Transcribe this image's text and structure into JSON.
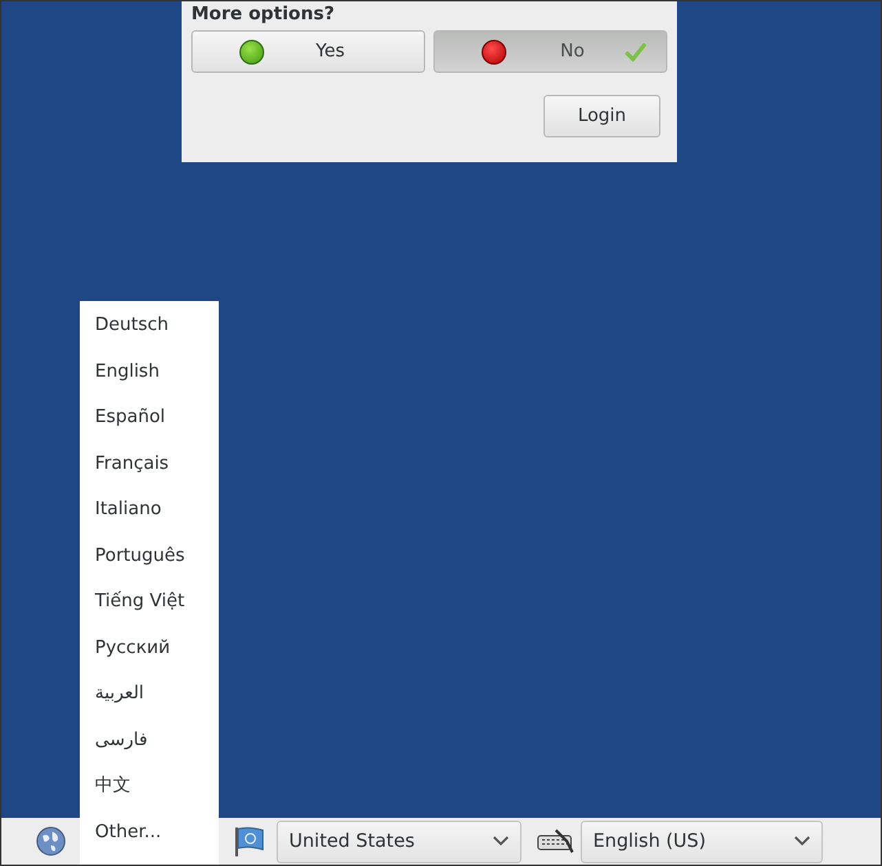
{
  "dialog": {
    "title": "More options?",
    "options": [
      {
        "label": "Yes",
        "kind": "yes",
        "selected": false
      },
      {
        "label": "No",
        "kind": "no",
        "selected": true
      }
    ],
    "login_button": "Login"
  },
  "language_menu": {
    "items": [
      "Deutsch",
      "English",
      "Español",
      "Français",
      "Italiano",
      "Português",
      "Tiếng Việt",
      "Русский",
      "العربية",
      "فارسی",
      "中文",
      "Other..."
    ]
  },
  "bottom_bar": {
    "region": "United States",
    "keyboard_layout": "English (US)"
  }
}
